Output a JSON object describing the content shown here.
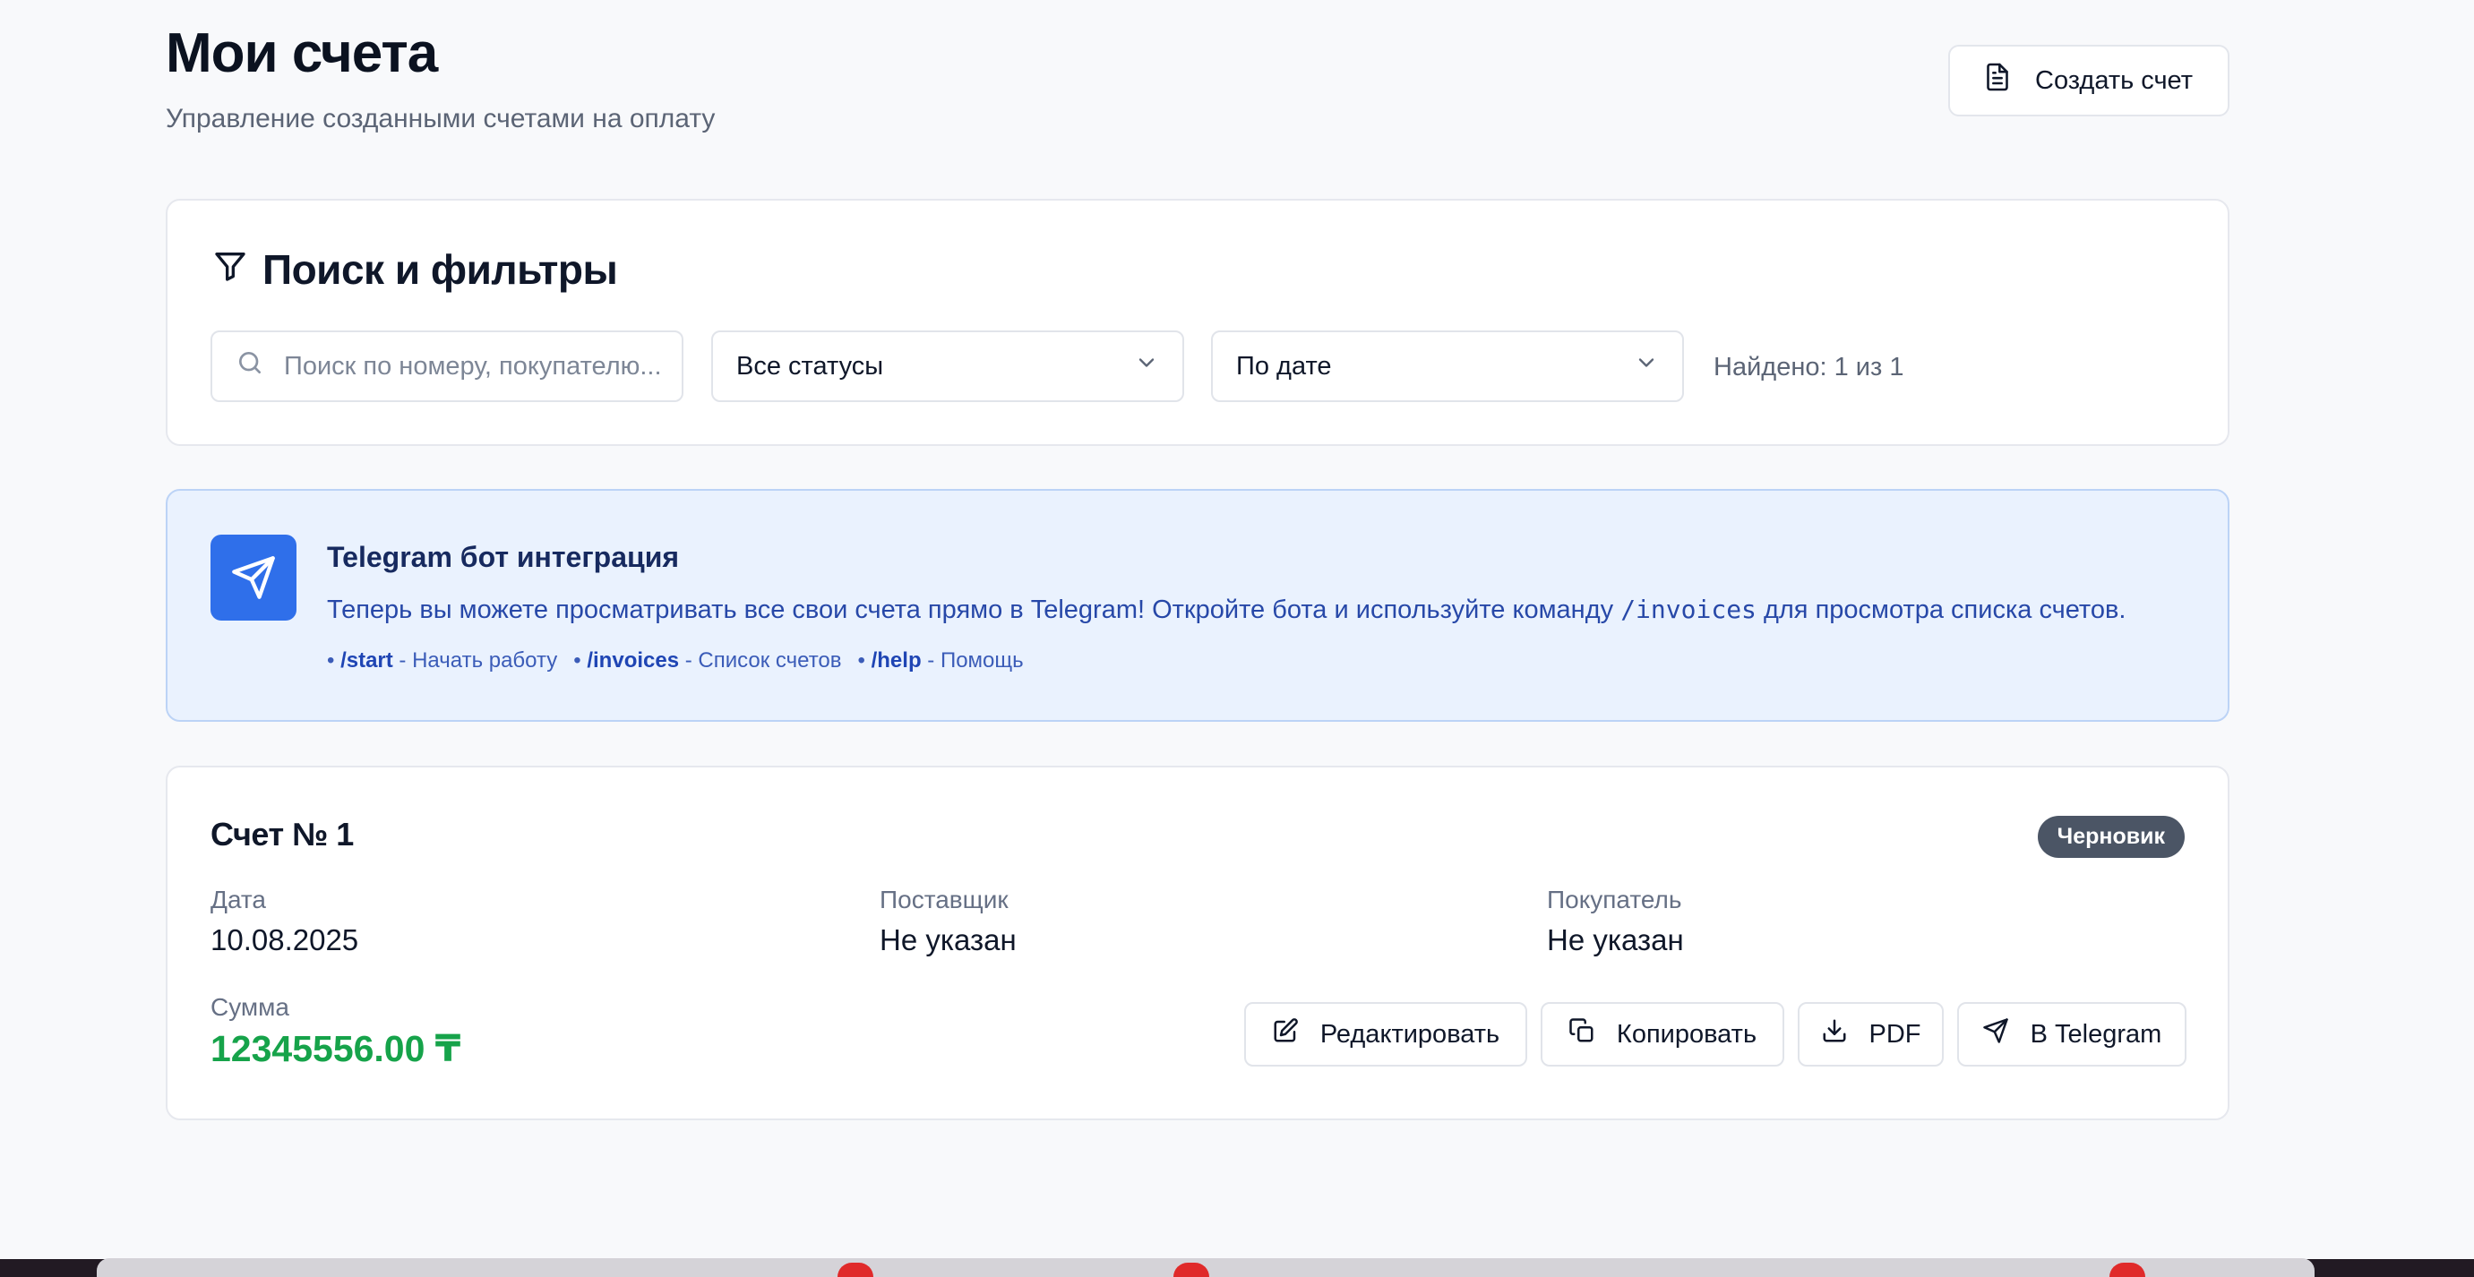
{
  "header": {
    "title": "Мои счета",
    "subtitle": "Управление созданными счетами на оплату",
    "create_button": "Создать счет"
  },
  "filters": {
    "title": "Поиск и фильтры",
    "search_placeholder": "Поиск по номеру, покупателю...",
    "status_select": "Все статусы",
    "sort_select": "По дате",
    "found_text": "Найдено: 1 из 1"
  },
  "telegram": {
    "title": "Telegram бот интеграция",
    "desc_before": "Теперь вы можете просматривать все свои счета прямо в Telegram! Откройте бота и используйте команду ",
    "desc_code": "/invoices",
    "desc_after": " для просмотра списка счетов.",
    "commands": [
      {
        "cmd": "/start",
        "text": " - Начать работу"
      },
      {
        "cmd": "/invoices",
        "text": " - Список счетов"
      },
      {
        "cmd": "/help",
        "text": " - Помощь"
      }
    ]
  },
  "invoice": {
    "title": "Счет № 1",
    "status": "Черновик",
    "date_label": "Дата",
    "date_value": "10.08.2025",
    "supplier_label": "Поставщик",
    "supplier_value": "Не указан",
    "buyer_label": "Покупатель",
    "buyer_value": "Не указан",
    "sum_label": "Сумма",
    "sum_value": "12345556.00 ₸",
    "actions": {
      "edit": "Редактировать",
      "copy": "Копировать",
      "pdf": "PDF",
      "telegram": "В Telegram"
    }
  },
  "colors": {
    "accent_blue": "#2f6fea",
    "sum_green": "#16a34a",
    "badge_gray": "#4b5565"
  }
}
